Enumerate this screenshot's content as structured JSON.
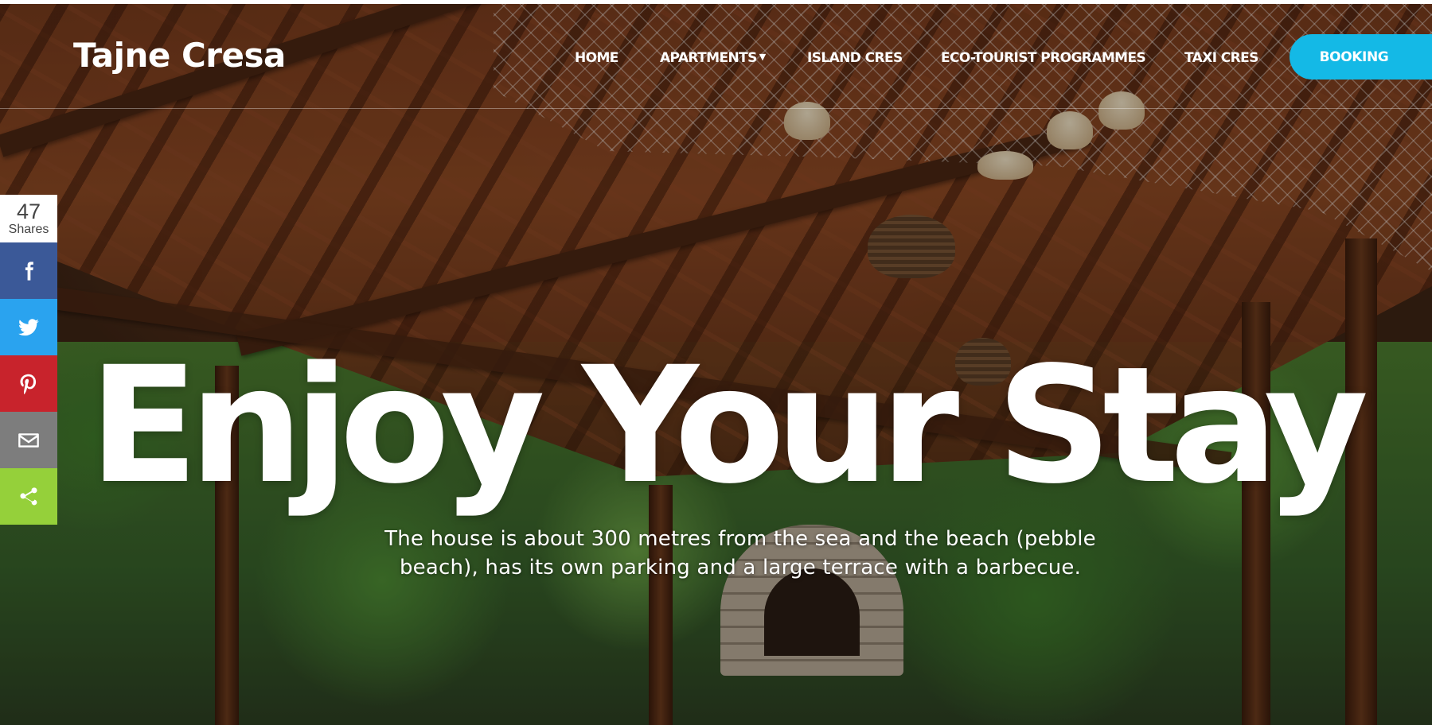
{
  "header": {
    "logo": "Tajne Cresa",
    "nav": [
      {
        "label": "HOME",
        "has_dropdown": false
      },
      {
        "label": "APARTMENTS",
        "has_dropdown": true
      },
      {
        "label": "ISLAND CRES",
        "has_dropdown": false
      },
      {
        "label": "ECO-TOURIST PROGRAMMES",
        "has_dropdown": false
      },
      {
        "label": "TAXI CRES",
        "has_dropdown": false
      }
    ],
    "booking_label": "BOOKING",
    "booking_color": "#14b9e6"
  },
  "share": {
    "count": "47",
    "count_label": "Shares",
    "buttons": [
      {
        "name": "facebook",
        "icon": "facebook-icon",
        "color": "#3b5998"
      },
      {
        "name": "twitter",
        "icon": "twitter-icon",
        "color": "#2aa3ef"
      },
      {
        "name": "pinterest",
        "icon": "pinterest-icon",
        "color": "#c8232c"
      },
      {
        "name": "email",
        "icon": "email-icon",
        "color": "#7d7d7d"
      },
      {
        "name": "share",
        "icon": "share-icon",
        "color": "#95d03a"
      }
    ]
  },
  "hero": {
    "headline": "Enjoy Your Stay",
    "subtitle_line1": "The house is about 300 metres from the sea and the beach (pebble",
    "subtitle_line2": "beach), has its own parking and a large terrace with a barbecue."
  }
}
